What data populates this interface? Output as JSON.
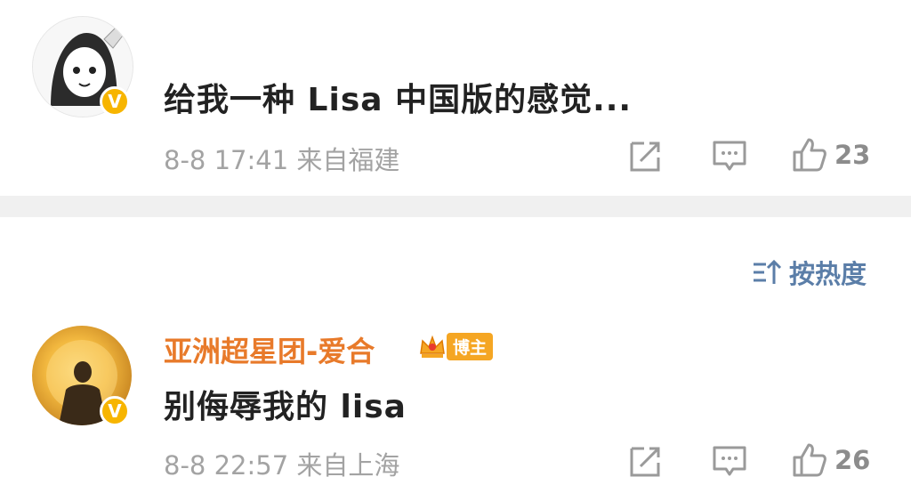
{
  "comments": [
    {
      "text": "给我一种 Lisa 中国版的感觉...",
      "time": "8-8 17:41",
      "source": "来自福建",
      "likes": "23",
      "badge": "V"
    },
    {
      "username": "亚洲超星团-爱合",
      "tag": "博主",
      "text": "别侮辱我的 lisa",
      "time": "8-8 22:57",
      "source": "来自上海",
      "likes": "26",
      "badge": "V"
    }
  ],
  "sort": {
    "label": "按热度"
  },
  "colors": {
    "username": "#e87a2a",
    "badge": "#f7b500",
    "sort": "#5b7ea8",
    "meta": "#a3a3a3"
  },
  "icons": [
    "share-icon",
    "comment-icon",
    "like-icon",
    "sort-icon",
    "crown-icon"
  ]
}
